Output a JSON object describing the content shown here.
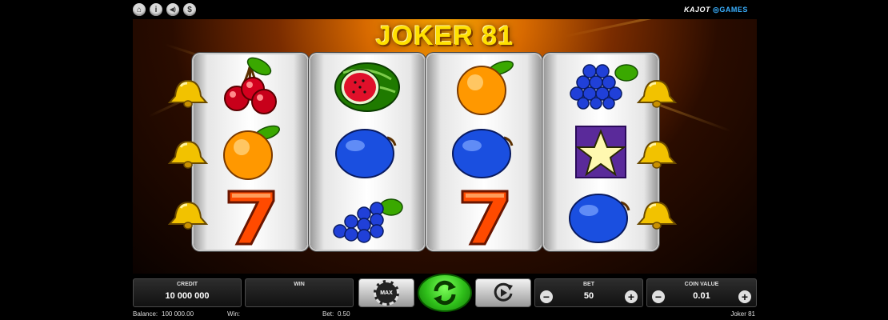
{
  "brand": {
    "name": "KAJOT",
    "games": "GAMES"
  },
  "top_icons": [
    {
      "name": "home-icon",
      "glyph": "⌂"
    },
    {
      "name": "info-icon",
      "glyph": "i"
    },
    {
      "name": "sound-icon",
      "glyph": "◀)"
    },
    {
      "name": "paytable-icon",
      "glyph": "$"
    }
  ],
  "game_title": "JOKER 81",
  "reels": [
    [
      "cherries",
      "orange",
      "seven"
    ],
    [
      "watermelon",
      "plum",
      "grapes"
    ],
    [
      "orange",
      "plum",
      "seven"
    ],
    [
      "grapes",
      "star",
      "plum"
    ]
  ],
  "controls": {
    "credit_label": "CREDIT",
    "credit_value": "10 000 000",
    "win_label": "WIN",
    "win_value": "",
    "max_label": "MAX",
    "bet_label": "BET",
    "bet_value": "50",
    "coin_label": "COIN VALUE",
    "coin_value": "0.01",
    "minus": "−",
    "plus": "+"
  },
  "footer": {
    "balance_label": "Balance:",
    "balance_value": "100 000.00",
    "win_label": "Win:",
    "win_value": "",
    "bet_label": "Bet:",
    "bet_value": "0.50",
    "game_name": "Joker 81"
  },
  "colors": {
    "title": "#ffe000",
    "spin_button": "#2fbf1a",
    "brand_games": "#3ab0ff"
  }
}
